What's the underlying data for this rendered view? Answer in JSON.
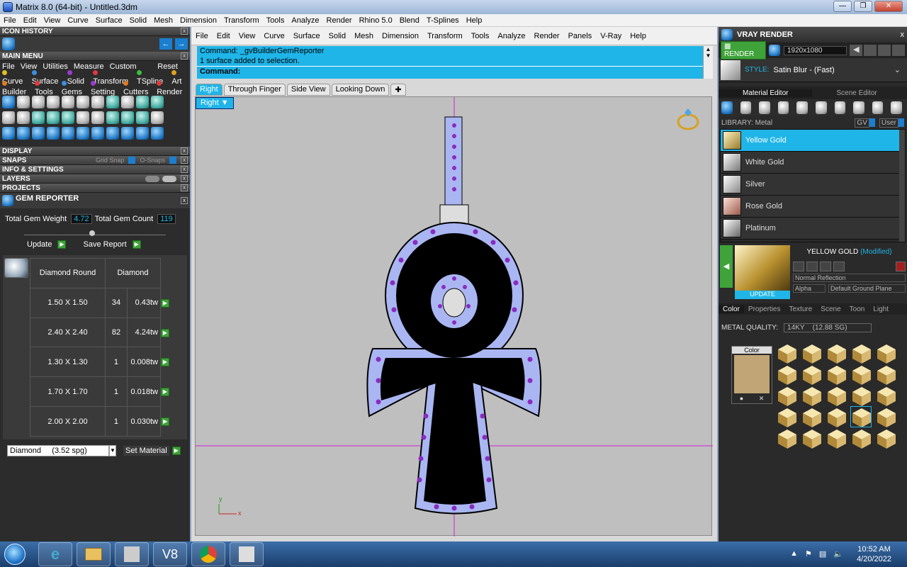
{
  "window": {
    "title": "Matrix 8.0 (64-bit) - Untitled.3dm"
  },
  "menubar": [
    "File",
    "Edit",
    "View",
    "Curve",
    "Surface",
    "Solid",
    "Mesh",
    "Dimension",
    "Transform",
    "Tools",
    "Analyze",
    "Render",
    "Rhino 5.0",
    "Blend",
    "T-Splines",
    "Help"
  ],
  "left": {
    "icon_history": "ICON HISTORY",
    "main_menu": "MAIN MENU",
    "menu_row1": [
      "File",
      "View",
      "Utilities",
      "Measure",
      "Custom"
    ],
    "reset": "Reset",
    "cat_row1": [
      {
        "label": "Curve",
        "color": "#e0c020"
      },
      {
        "label": "Surface",
        "color": "#3b8fe0"
      },
      {
        "label": "Solid",
        "color": "#9b3bd0"
      },
      {
        "label": "Transform",
        "color": "#e03a3a"
      },
      {
        "label": "TSpline",
        "color": "#3bbf3b"
      },
      {
        "label": "Art",
        "color": "#e0a020"
      }
    ],
    "cat_row2": [
      {
        "label": "Builder",
        "color": "#e07a20"
      },
      {
        "label": "Tools",
        "color": "#e03a3a"
      },
      {
        "label": "Gems",
        "color": "#3b8fe0"
      },
      {
        "label": "Setting",
        "color": "#9b3bd0"
      },
      {
        "label": "Cutters",
        "color": "#e07a20"
      },
      {
        "label": "Render",
        "color": "#e03a3a"
      }
    ],
    "sections": {
      "display": "DISPLAY",
      "snaps": "SNAPS",
      "grid_snap": "Grid Snap",
      "o_snaps": "O-Snaps",
      "info": "INFO & SETTINGS",
      "layers": "LAYERS",
      "projects": "PROJECTS",
      "gem_reporter": "GEM REPORTER"
    },
    "gem": {
      "total_weight_label": "Total Gem Weight",
      "total_weight": "4.72",
      "total_count_label": "Total Gem Count",
      "total_count": "119",
      "update": "Update",
      "save_report": "Save Report",
      "col1": "Diamond Round",
      "col2": "Diamond",
      "rows": [
        {
          "size": "1.50 X 1.50",
          "count": "34",
          "tw": "0.43tw"
        },
        {
          "size": "2.40 X 2.40",
          "count": "82",
          "tw": "4.24tw"
        },
        {
          "size": "1.30 X 1.30",
          "count": "1",
          "tw": "0.008tw"
        },
        {
          "size": "1.70 X 1.70",
          "count": "1",
          "tw": "0.018tw"
        },
        {
          "size": "2.00 X 2.00",
          "count": "1",
          "tw": "0.030tw"
        }
      ],
      "material_select": "Diamond     (3.52 spg)",
      "set_material": "Set Material"
    }
  },
  "main": {
    "menu": [
      "File",
      "Edit",
      "View",
      "Curve",
      "Surface",
      "Solid",
      "Mesh",
      "Dimension",
      "Transform",
      "Tools",
      "Analyze",
      "Render",
      "Panels",
      "V-Ray",
      "Help"
    ],
    "cmd_line1": "Command: _gvBuilderGemReporter",
    "cmd_line2": "1 surface added to selection.",
    "cmd_prompt": "Command:",
    "tabs": [
      "Right",
      "Through Finger",
      "Side View",
      "Looking Down"
    ],
    "viewport_label": "Right",
    "axis_y": "y",
    "axis_x": "x"
  },
  "right": {
    "title": "VRAY RENDER",
    "render": "RENDER",
    "resolution": "1920x1080",
    "style_label": "STYLE:",
    "style_value": "Satin Blur - (Fast)",
    "tab_material": "Material Editor",
    "tab_scene": "Scene Editor",
    "library": "LIBRARY: Metal",
    "gv": "GV",
    "user": "User",
    "materials": [
      "Yellow Gold",
      "White Gold",
      "Silver",
      "Rose Gold",
      "Platinum"
    ],
    "preview_name": "YELLOW GOLD",
    "modified": "(Modified)",
    "update": "UPDATE",
    "reflection": "Normal Reflection",
    "alpha": "Alpha",
    "ground": "Default Ground Plane",
    "prop_tabs": [
      "Color",
      "Properties",
      "Texture",
      "Scene",
      "Toon",
      "Light"
    ],
    "metal_quality_label": "METAL QUALITY:",
    "metal_quality": "14KY",
    "metal_sg": "(12.88 SG)",
    "color_label": "Color",
    "swatch_color": "#c1a576"
  },
  "taskbar": {
    "time": "10:52 AM",
    "date": "4/20/2022"
  }
}
